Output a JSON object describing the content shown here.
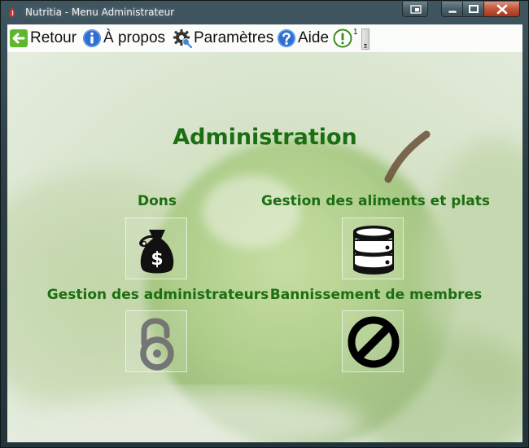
{
  "window": {
    "title": "Nutritia - Menu Administrateur"
  },
  "toolbar": {
    "back_label": "Retour",
    "about_label": "À propos",
    "settings_label": "Paramètres",
    "help_label": "Aide",
    "notifications_count": "1"
  },
  "main": {
    "heading": "Administration",
    "tiles": [
      {
        "label": "Dons",
        "icon": "money-bag-icon"
      },
      {
        "label": "Gestion des aliments et plats",
        "icon": "database-icon"
      },
      {
        "label": "Gestion des administrateurs",
        "icon": "unlocked-padlock-icon"
      },
      {
        "label": "Bannissement de membres",
        "icon": "ban-icon"
      }
    ]
  },
  "colors": {
    "heading_green": "#1b6e12",
    "background_apple": "#9cc27a"
  }
}
